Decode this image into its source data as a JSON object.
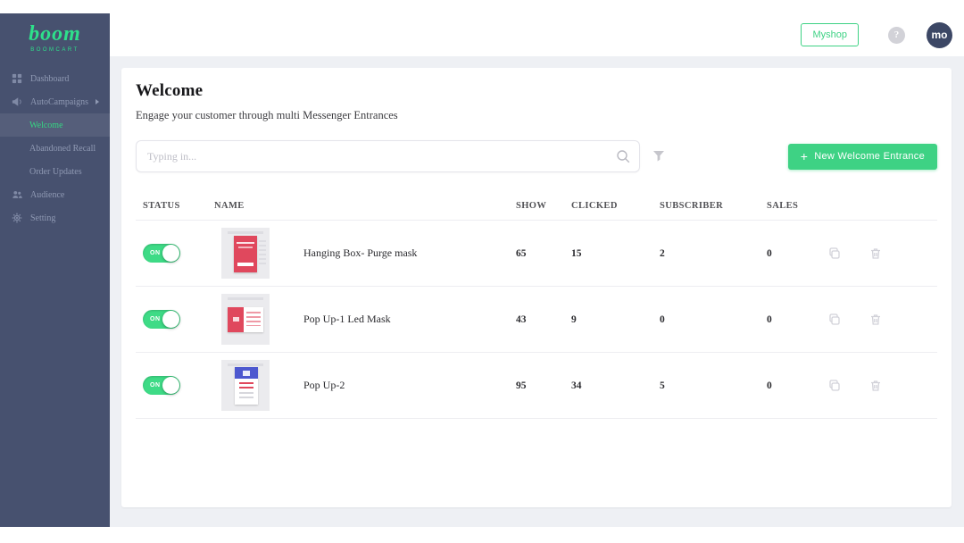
{
  "brand": {
    "logo_text": "boom",
    "logo_sub": "BOOMCART",
    "accent_green": "#3ed284",
    "sidebar_navy": "#47516f"
  },
  "header": {
    "shop_button": "Myshop",
    "help_glyph": "?",
    "avatar_initials": "mo"
  },
  "sidebar": {
    "items": [
      {
        "label": "Dashboard",
        "icon": "dashboard-icon"
      },
      {
        "label": "AutoCampaigns",
        "icon": "campaign-icon",
        "expanded": true
      },
      {
        "label": "Audience",
        "icon": "audience-icon"
      },
      {
        "label": "Setting",
        "icon": "gear-icon"
      }
    ],
    "submenu": [
      {
        "label": "Welcome",
        "active": true
      },
      {
        "label": "Abandoned Recall",
        "active": false
      },
      {
        "label": "Order Updates",
        "active": false
      }
    ]
  },
  "main": {
    "title": "Welcome",
    "subtitle": "Engage your customer through multi Messenger Entrances",
    "search_placeholder": "Typing in...",
    "new_entrance": {
      "plus": "+",
      "label": "New Welcome Entrance"
    }
  },
  "table": {
    "headers": [
      "STATUS",
      "NAME",
      "SHOW",
      "CLICKED",
      "SUBSCRIBER",
      "SALES"
    ],
    "rows": [
      {
        "status": "ON",
        "name": "Hanging Box- Purge mask",
        "show": 65,
        "clicked": 15,
        "subscriber": 2,
        "sales": 0,
        "thumbnail": "red-modal"
      },
      {
        "status": "ON",
        "name": "Pop Up-1 Led Mask",
        "show": 43,
        "clicked": 9,
        "subscriber": 0,
        "sales": 0,
        "thumbnail": "split-red-popup"
      },
      {
        "status": "ON",
        "name": "Pop Up-2",
        "show": 95,
        "clicked": 34,
        "subscriber": 5,
        "sales": 0,
        "thumbnail": "blue-header-popup"
      }
    ]
  }
}
